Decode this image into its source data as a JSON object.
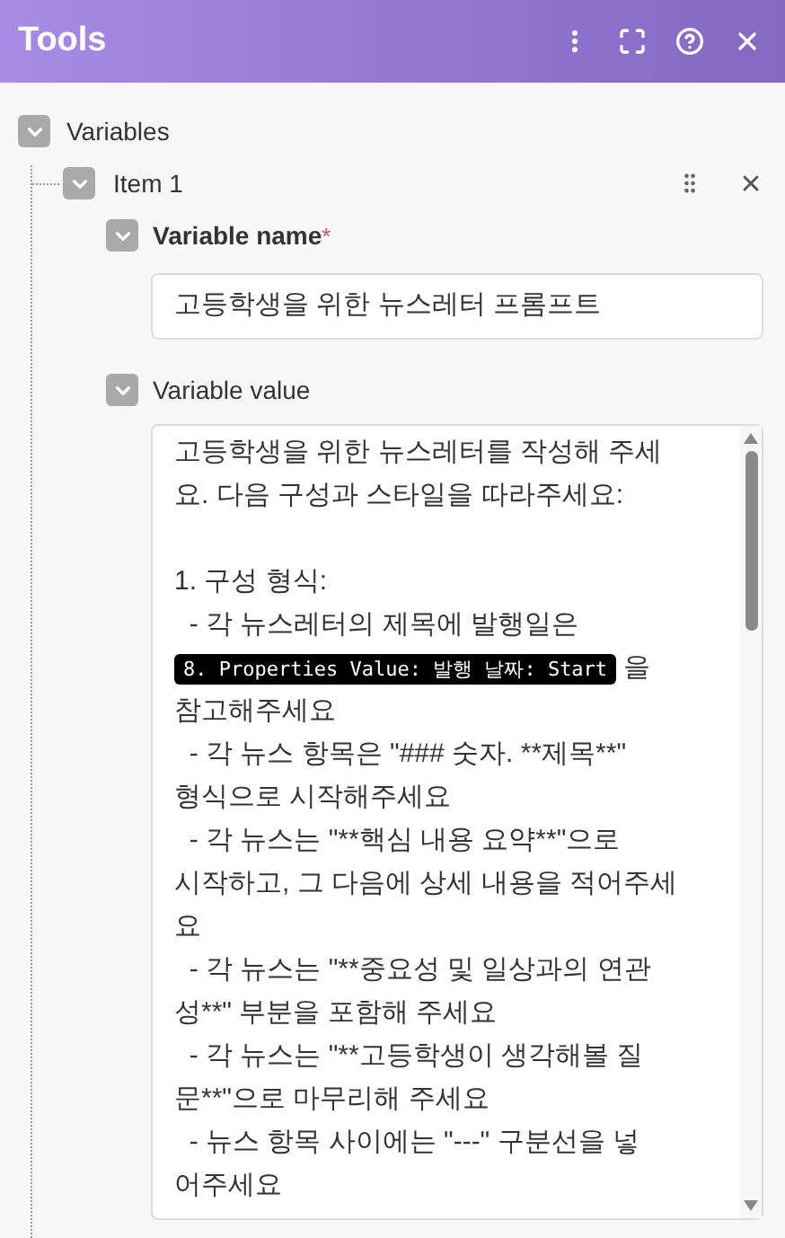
{
  "window": {
    "title": "Tools"
  },
  "header_actions": [
    {
      "kind": "more"
    },
    {
      "kind": "expand"
    },
    {
      "kind": "help"
    },
    {
      "kind": "close"
    }
  ],
  "section": {
    "label": "Variables",
    "expanded": true
  },
  "item": {
    "label": "Item 1",
    "expanded": true
  },
  "name_field": {
    "label": "Variable name",
    "required_mark": "*",
    "expanded": true,
    "value": "고등학생을 위한 뉴스레터 프롬프트"
  },
  "value_field": {
    "label": "Variable value",
    "expanded": true,
    "lines": [
      [
        {
          "kind": "text",
          "text": "고등학생을 위한 뉴스레터를 작성해 주세"
        }
      ],
      [
        {
          "kind": "text",
          "text": "요. 다음 구성과 스타일을 따라주세요:"
        }
      ],
      [
        {
          "kind": "blank"
        }
      ],
      [
        {
          "kind": "text",
          "text": "1. 구성 형식:"
        }
      ],
      [
        {
          "kind": "text",
          "text": "  - 각 뉴스레터의 제목에 발행일은"
        }
      ],
      [
        {
          "kind": "token",
          "text": "8. Properties Value: 발행 날짜: Start"
        },
        {
          "kind": "text",
          "text": " 을"
        }
      ],
      [
        {
          "kind": "text",
          "text": "참고해주세요"
        }
      ],
      [
        {
          "kind": "text",
          "text": "  - 각 뉴스 항목은 \"### 숫자. **제목**\""
        }
      ],
      [
        {
          "kind": "text",
          "text": "형식으로 시작해주세요"
        }
      ],
      [
        {
          "kind": "text",
          "text": "  - 각 뉴스는 \"**핵심 내용 요약**\"으로"
        }
      ],
      [
        {
          "kind": "text",
          "text": "시작하고, 그 다음에 상세 내용을 적어주세"
        }
      ],
      [
        {
          "kind": "text",
          "text": "요"
        }
      ],
      [
        {
          "kind": "text",
          "text": "  - 각 뉴스는 \"**중요성 및 일상과의 연관"
        }
      ],
      [
        {
          "kind": "text",
          "text": "성**\" 부분을 포함해 주세요"
        }
      ],
      [
        {
          "kind": "text",
          "text": "  - 각 뉴스는 \"**고등학생이 생각해볼 질"
        }
      ],
      [
        {
          "kind": "text",
          "text": "문**\"으로 마무리해 주세요"
        }
      ],
      [
        {
          "kind": "text",
          "text": "  - 뉴스 항목 사이에는 \"---\" 구분선을 넣"
        }
      ],
      [
        {
          "kind": "text",
          "text": "어주세요"
        }
      ]
    ]
  }
}
